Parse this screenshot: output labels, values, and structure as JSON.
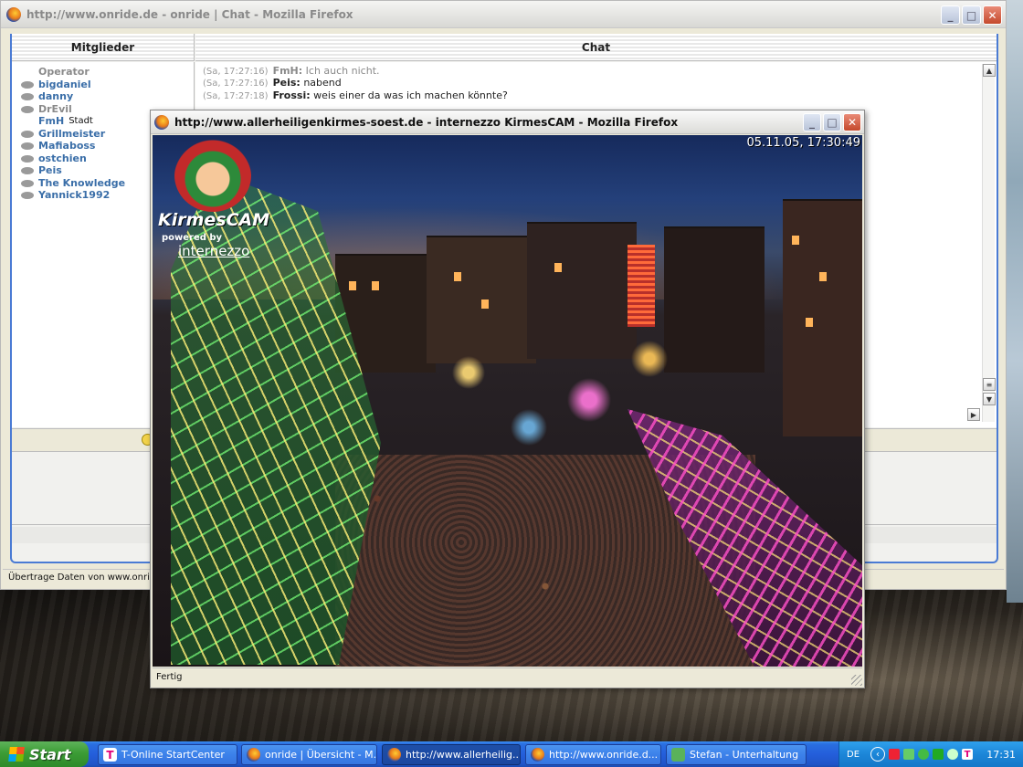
{
  "main_window": {
    "title": "http://www.onride.de - onride | Chat - Mozilla Firefox",
    "members_header": "Mitglieder",
    "chat_header": "Chat",
    "members": [
      {
        "name": "Operator",
        "style": "gray",
        "icon": "none"
      },
      {
        "name": "bigdaniel",
        "style": "blue",
        "icon": "chat-bubble-icon"
      },
      {
        "name": "danny",
        "style": "blue",
        "icon": "chat-bubble-icon"
      },
      {
        "name": "DrEvil",
        "style": "gray",
        "icon": "chat-bubble-icon"
      },
      {
        "name": "FmH",
        "style": "blue",
        "icon": "none",
        "tag": "Stadt"
      },
      {
        "name": "Grillmeister",
        "style": "blue",
        "icon": "chat-bubble-icon"
      },
      {
        "name": "Mafiaboss",
        "style": "blue",
        "icon": "chat-bubble-icon"
      },
      {
        "name": "ostchien",
        "style": "blue",
        "icon": "chat-bubble-icon"
      },
      {
        "name": "Peis",
        "style": "blue",
        "icon": "chat-bubble-icon"
      },
      {
        "name": "The Knowledge",
        "style": "blue",
        "icon": "chat-bubble-icon"
      },
      {
        "name": "Yannick1992",
        "style": "blue",
        "icon": "chat-bubble-icon"
      }
    ],
    "messages": [
      {
        "time": "(Sa, 17:27:16)",
        "nick": "FmH:",
        "text": "Ich auch nicht.",
        "faded": true
      },
      {
        "time": "(Sa, 17:27:16)",
        "nick": "Peis:",
        "text": "nabend",
        "faded": false
      },
      {
        "time": "(Sa, 17:27:18)",
        "nick": "Frossi:",
        "text": "weis einer da was ich machen könnte?",
        "faded": false
      }
    ],
    "status": "Übertrage Daten von www.onride"
  },
  "popup_window": {
    "title": "http://www.allerheiligenkirmes-soest.de - internezzo KirmesCAM - Mozilla Firefox",
    "timestamp": "05.11.05,  17:30:49",
    "logo_title": "KirmesCAM",
    "logo_powered": "powered by",
    "logo_brand": "internezzo",
    "status": "Fertig"
  },
  "taskbar": {
    "start_label": "Start",
    "tasks": [
      {
        "label": "T-Online StartCenter",
        "icon": "t-online-icon",
        "active": false
      },
      {
        "label": "onride | Übersicht - M...",
        "icon": "firefox-icon",
        "active": false
      },
      {
        "label": "http://www.allerheilig...",
        "icon": "firefox-icon",
        "active": true
      },
      {
        "label": "http://www.onride.d...",
        "icon": "firefox-icon",
        "active": false
      },
      {
        "label": "Stefan - Unterhaltung",
        "icon": "messenger-icon",
        "active": false
      }
    ],
    "language": "DE",
    "clock": "17:31"
  }
}
